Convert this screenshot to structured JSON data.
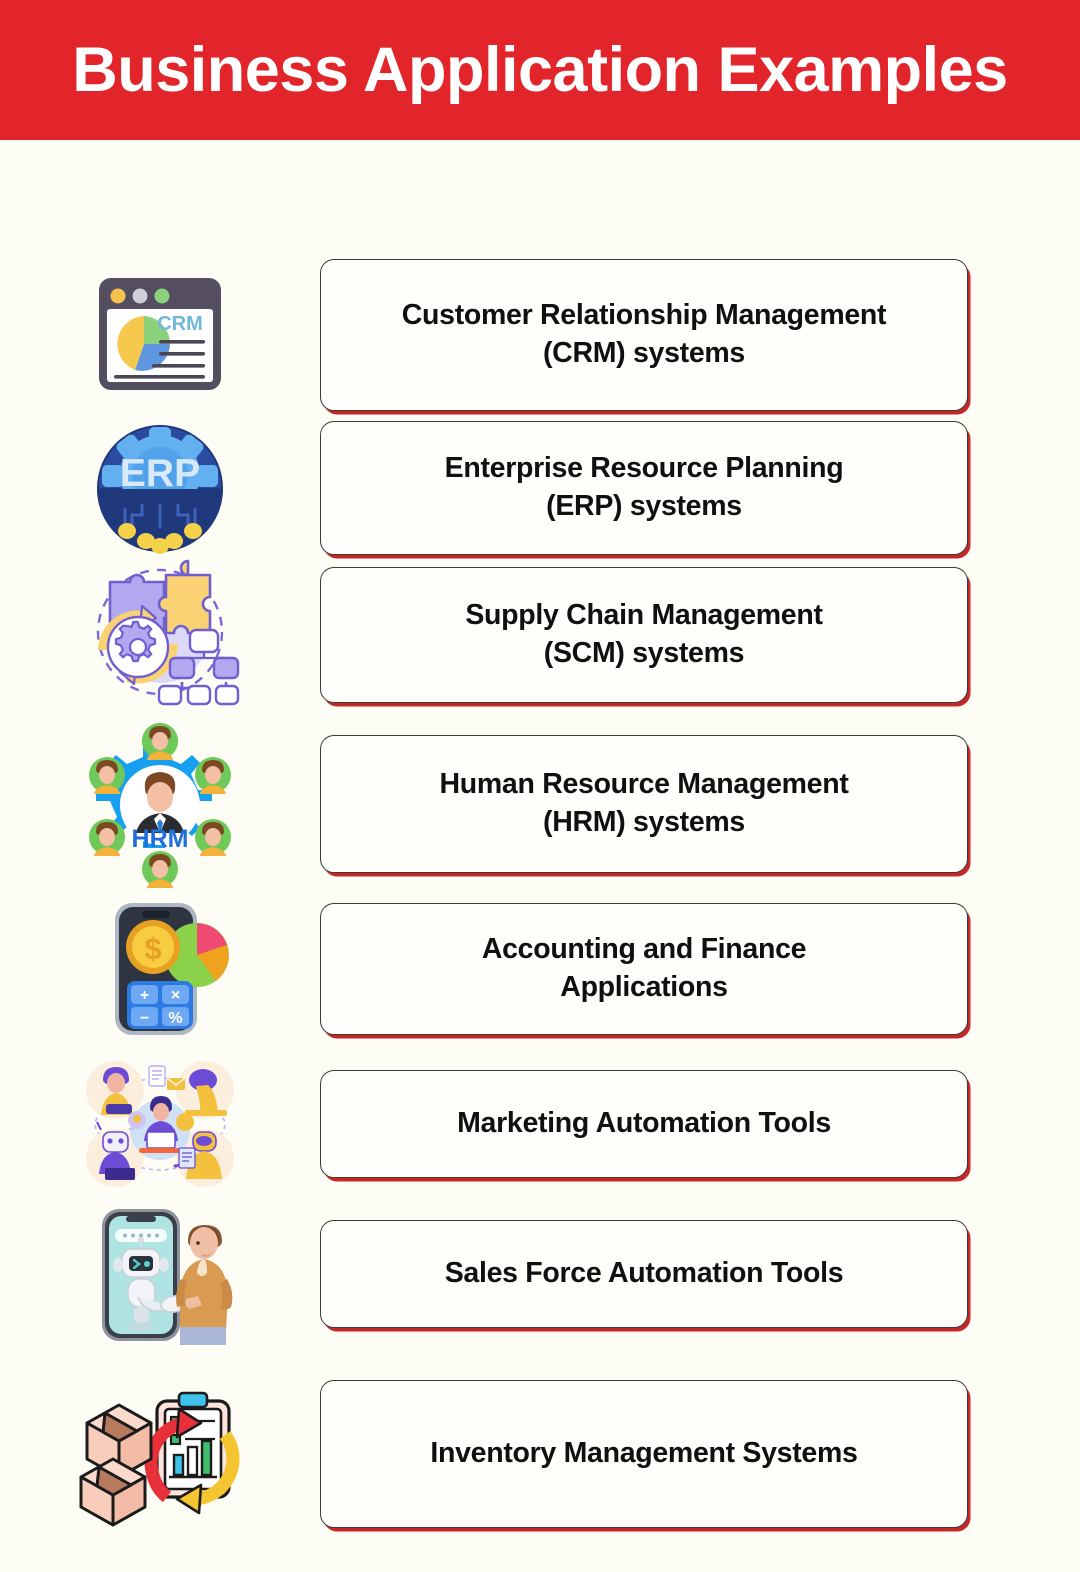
{
  "header": {
    "title": "Business Application Examples",
    "background_color": "#E1252B",
    "text_color": "#FFFFFF"
  },
  "page": {
    "background_color": "#FDFDF6",
    "card_border_color": "#3A3A3A",
    "card_shadow_color": "#C62828",
    "card_background_color": "#FEFEFB",
    "card_text_color": "#101010"
  },
  "items": [
    {
      "label": "Customer Relationship Management\n(CRM) systems",
      "icon": "crm-dashboard-icon",
      "icon_text": "CRM"
    },
    {
      "label": "Enterprise Resource Planning\n(ERP) systems",
      "icon": "erp-globe-gear-icon",
      "icon_text": "ERP"
    },
    {
      "label": "Supply Chain Management\n(SCM) systems",
      "icon": "scm-puzzle-gear-icon",
      "icon_text": ""
    },
    {
      "label": "Human Resource Management\n(HRM) systems",
      "icon": "hrm-people-gear-icon",
      "icon_text": "HRM"
    },
    {
      "label": "Accounting and Finance\nApplications",
      "icon": "accounting-phone-calculator-icon",
      "icon_text": ""
    },
    {
      "label": "Marketing Automation Tools",
      "icon": "marketing-team-network-icon",
      "icon_text": ""
    },
    {
      "label": "Sales Force Automation Tools",
      "icon": "sales-chatbot-handshake-icon",
      "icon_text": ""
    },
    {
      "label": "Inventory Management Systems",
      "icon": "inventory-boxes-clipboard-icon",
      "icon_text": ""
    }
  ]
}
